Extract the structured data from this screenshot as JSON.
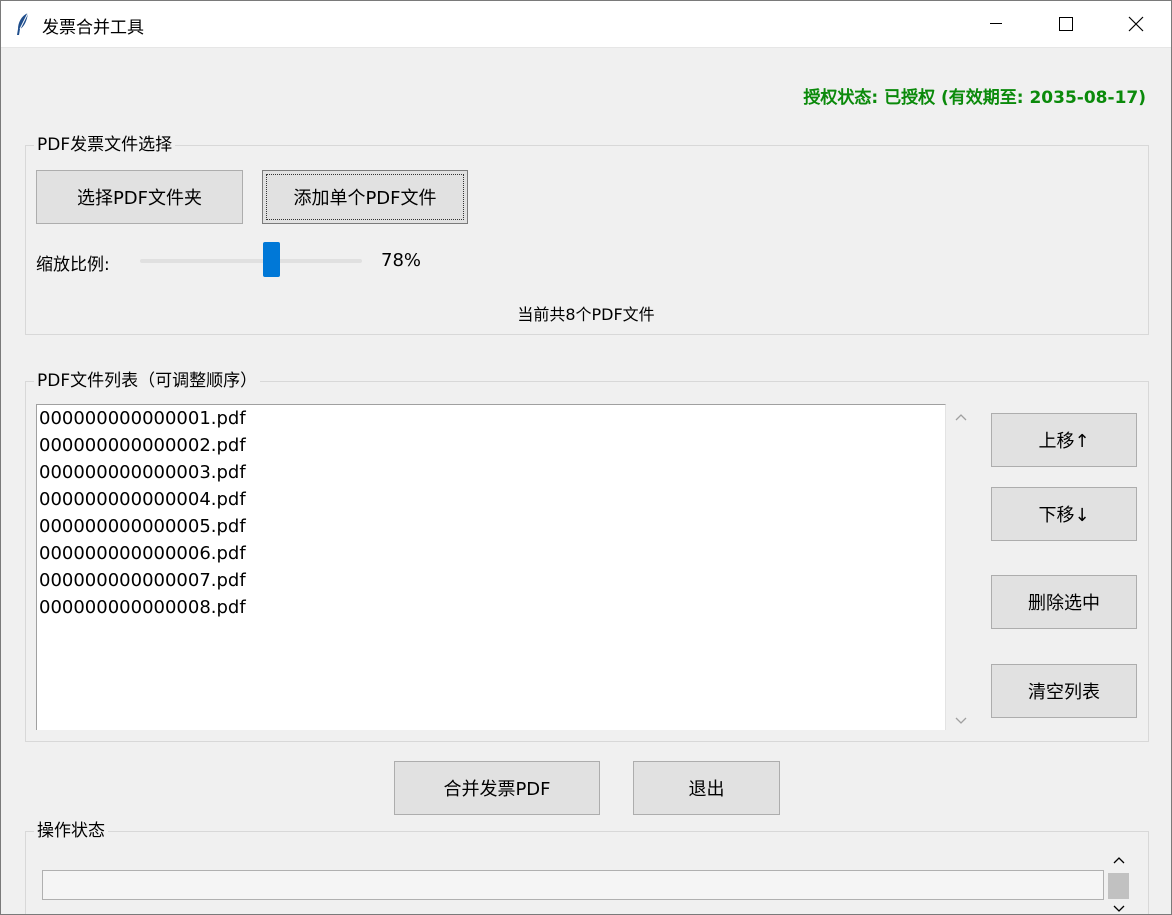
{
  "window": {
    "title": "发票合并工具",
    "icon": "feather-icon"
  },
  "auth_status": "授权状态: 已授权 (有效期至: 2035-08-17)",
  "file_select": {
    "group_label": "PDF发票文件选择",
    "select_folder_label": "选择PDF文件夹",
    "add_file_label": "添加单个PDF文件",
    "scale_label": "缩放比例:",
    "scale_value": 0.78,
    "scale_text": "78%",
    "file_count_text": "当前共8个PDF文件"
  },
  "file_list": {
    "group_label": "PDF文件列表（可调整顺序）",
    "items": [
      "000000000000001.pdf",
      "000000000000002.pdf",
      "000000000000003.pdf",
      "000000000000004.pdf",
      "000000000000005.pdf",
      "000000000000006.pdf",
      "000000000000007.pdf",
      "000000000000008.pdf"
    ],
    "move_up_label": "上移↑",
    "move_down_label": "下移↓",
    "delete_label": "删除选中",
    "clear_label": "清空列表"
  },
  "actions": {
    "merge_label": "合并发票PDF",
    "exit_label": "退出"
  },
  "operation": {
    "group_label": "操作状态"
  },
  "colors": {
    "auth_status": "#0b8a0b",
    "slider_thumb": "#0078d7"
  }
}
